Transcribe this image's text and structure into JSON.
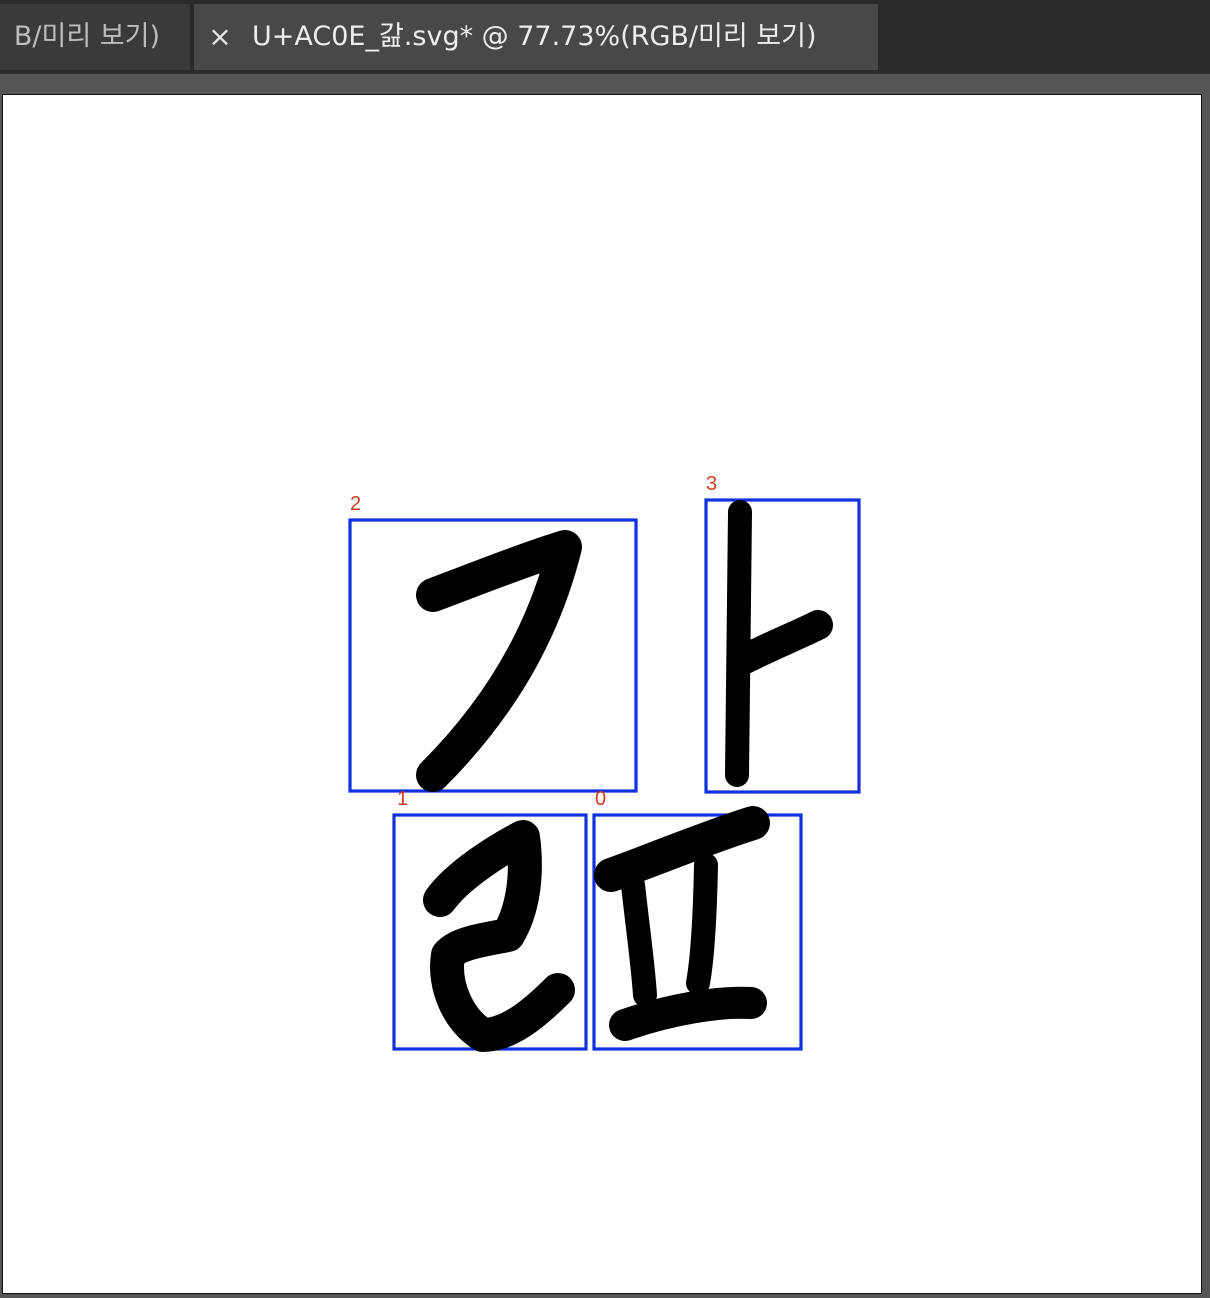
{
  "tabs": [
    {
      "label": "B/미리 보기)",
      "active": false
    },
    {
      "label": "U+AC0E_갎.svg* @ 77.73%(RGB/미리 보기)",
      "active": true,
      "close_symbol": "×"
    }
  ],
  "document": {
    "file_name": "U+AC0E_갎.svg*",
    "zoom": "77.73%",
    "color_mode": "RGB",
    "view_mode": "미리 보기"
  },
  "colors": {
    "box_stroke": "#1130e0",
    "label_color": "#d33a22",
    "ink": "#000000",
    "artboard": "#ffffff"
  },
  "components": [
    {
      "id": "2",
      "jamo": "ㄱ"
    },
    {
      "id": "3",
      "jamo": "ㅏ"
    },
    {
      "id": "1",
      "jamo": "ㄹ"
    },
    {
      "id": "0",
      "jamo": "ㅍ"
    }
  ]
}
